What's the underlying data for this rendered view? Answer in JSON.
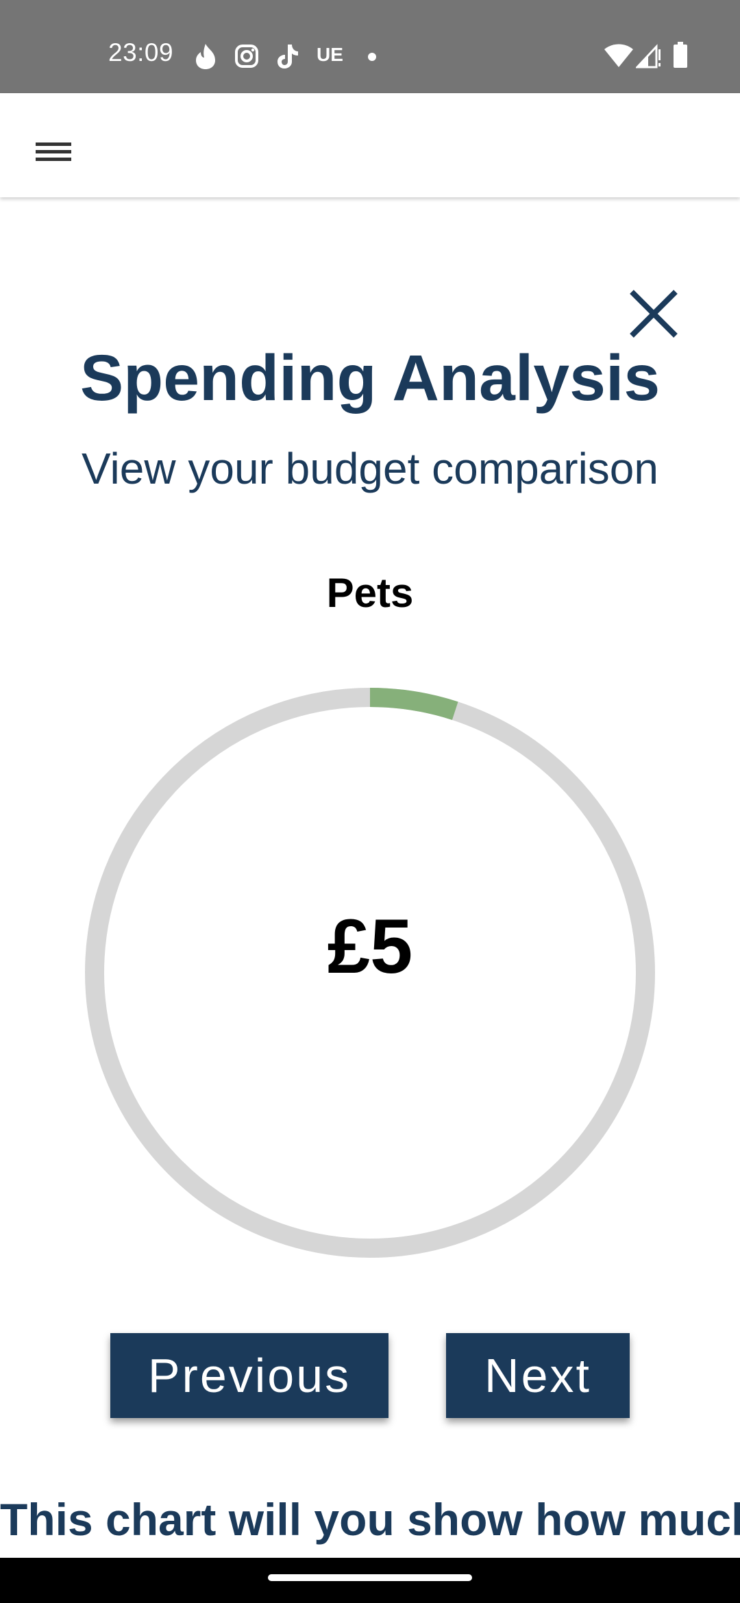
{
  "status_bar": {
    "time": "23:09",
    "carrier_label": "UE",
    "icons": [
      "tinder-flame-icon",
      "instagram-icon",
      "tiktok-icon",
      "dot-icon",
      "wifi-icon",
      "signal-icon",
      "battery-icon"
    ]
  },
  "app_bar": {
    "menu_icon": "hamburger-menu-icon"
  },
  "modal": {
    "close_icon": "close-icon",
    "title": "Spending Analysis",
    "subtitle": "View your budget comparison",
    "category": "Pets",
    "amount": "£5",
    "gauge_progress_fraction": 0.05,
    "previous_label": "Previous",
    "next_label": "Next",
    "description": "This chart will you show how much"
  },
  "colors": {
    "primary": "#1b3a5a",
    "gauge_track": "#d6d6d6",
    "gauge_fill": "#86b07a",
    "status_bar": "#757575"
  }
}
